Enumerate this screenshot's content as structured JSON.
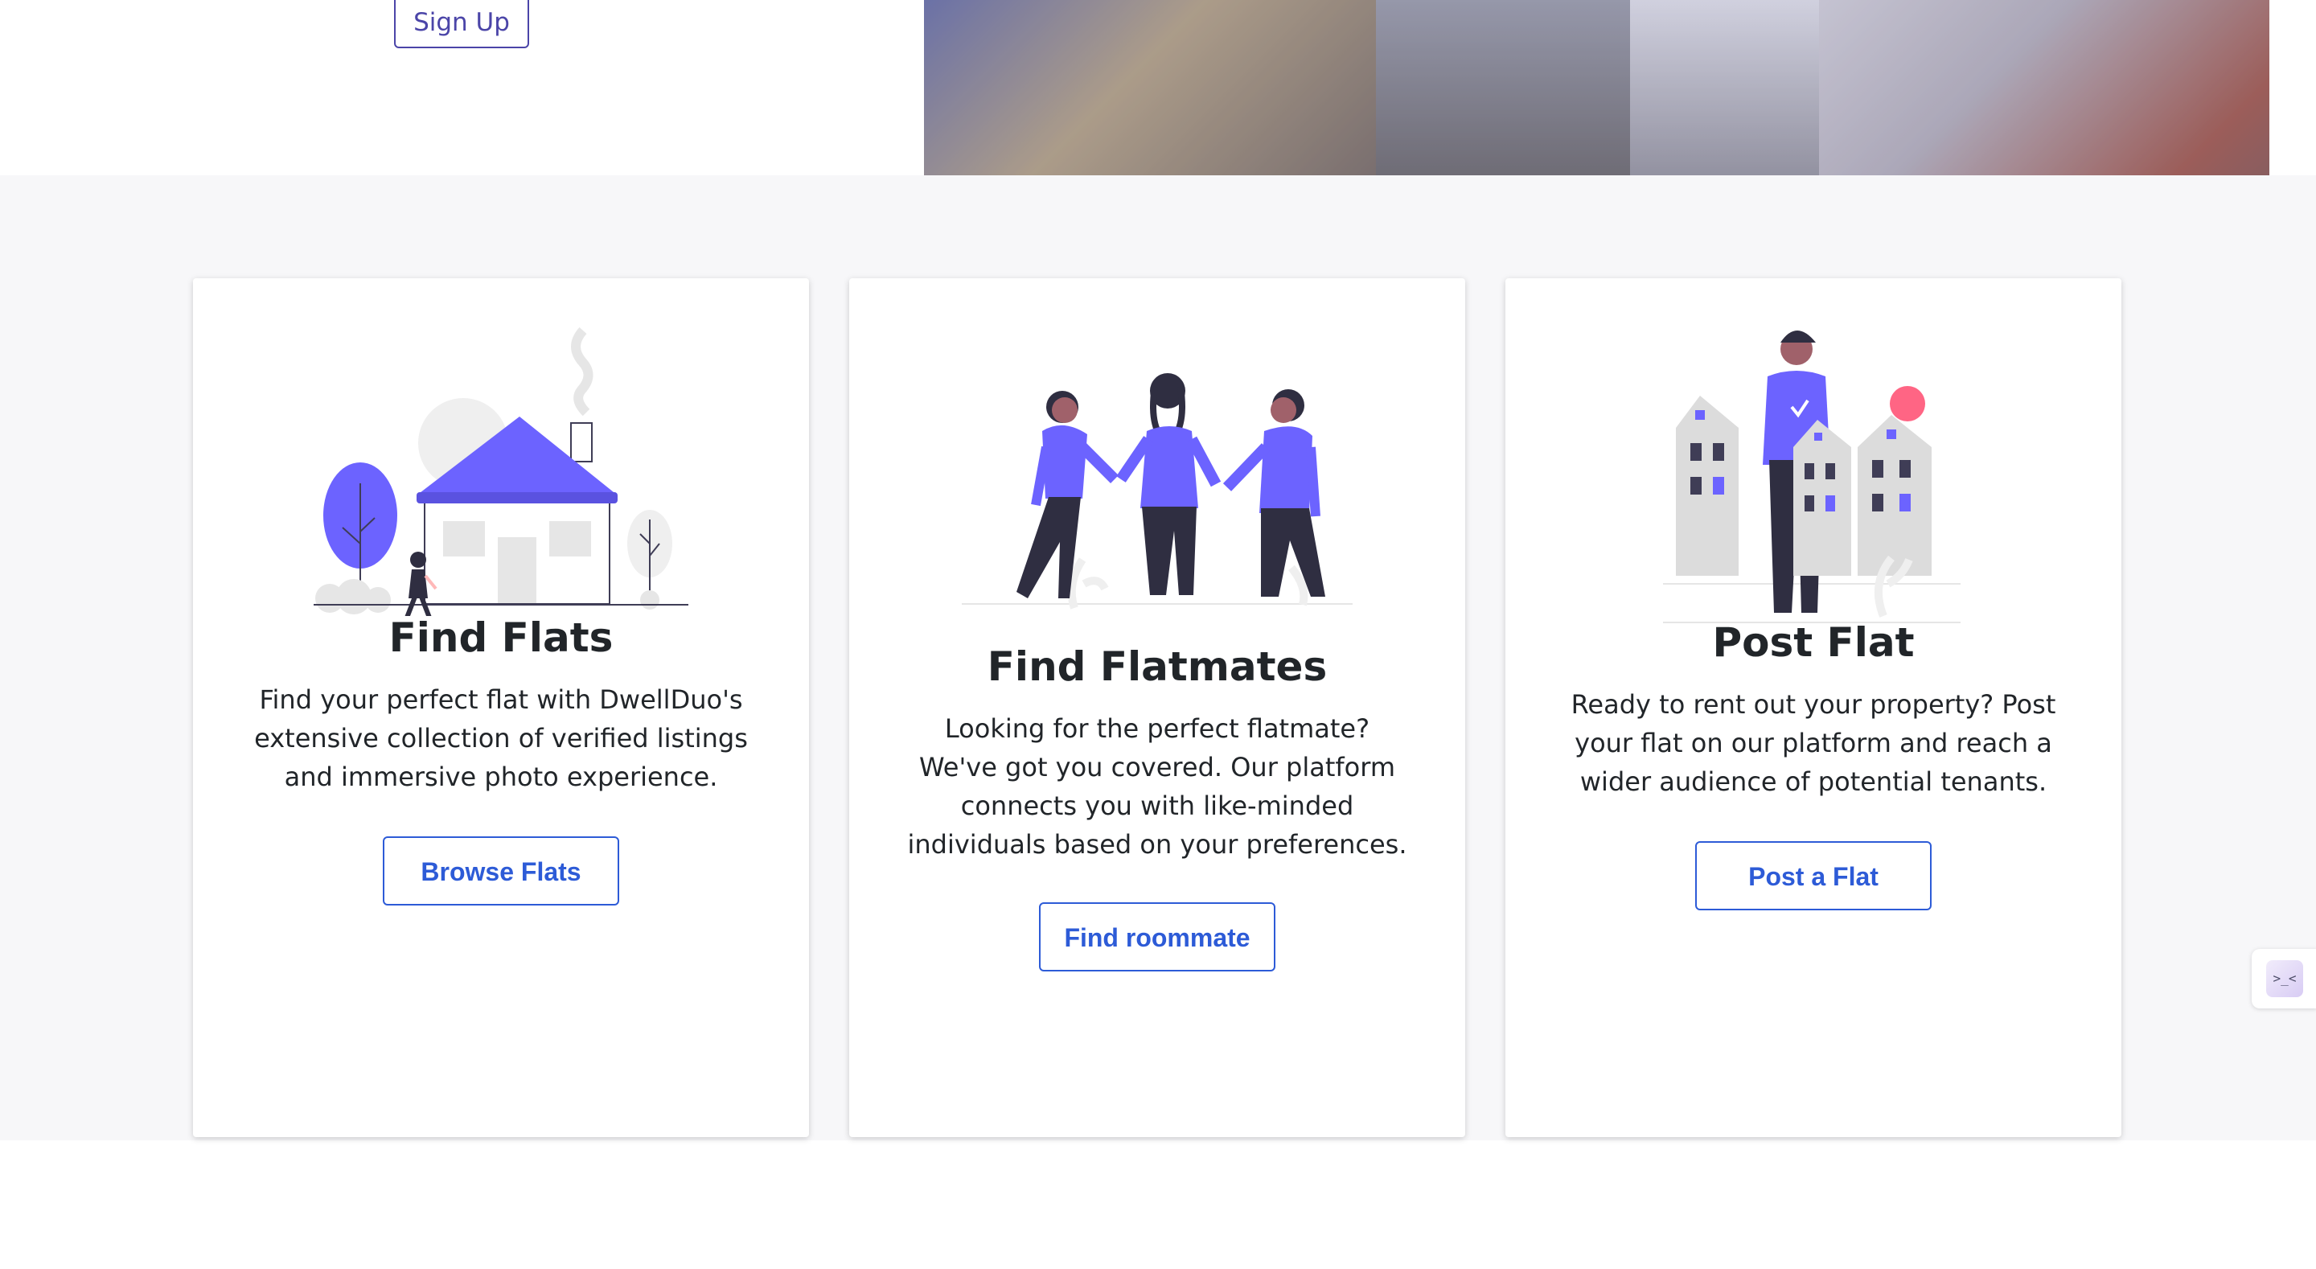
{
  "hero": {
    "signup_label": "Sign Up"
  },
  "features": [
    {
      "title": "Find Flats",
      "description": "Find your perfect flat with DwellDuo's extensive collection of verified listings and immersive photo experience.",
      "button": "Browse Flats",
      "illustration": "house-icon"
    },
    {
      "title": "Find Flatmates",
      "description": "Looking for the perfect flatmate? We've got you covered. Our platform connects you with like-minded individuals based on your preferences.",
      "button": "Find roommate",
      "illustration": "people-holding-hands-icon"
    },
    {
      "title": "Post Flat",
      "description": "Ready to rent out your property? Post your flat on our platform and reach a wider audience of potential tenants.",
      "button": "Post a Flat",
      "illustration": "person-with-houses-icon"
    }
  ],
  "colors": {
    "accent": "#6c63ff",
    "button": "#2d5bd7",
    "section_bg": "#f7f7f9"
  },
  "side_widget": {
    "label": ">_<",
    "icon": "face-widget-icon"
  }
}
